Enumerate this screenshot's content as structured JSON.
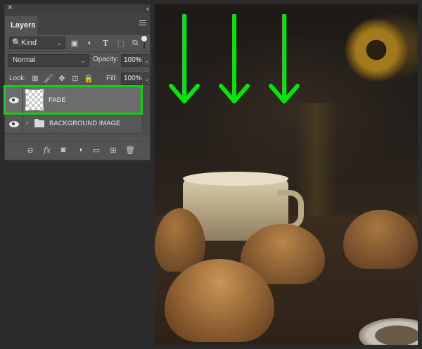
{
  "panel": {
    "title": "Layers",
    "close_glyph": "✕",
    "collapse_glyph": "‹‹",
    "filter": {
      "kind_label": "Kind",
      "search_glyph": "🔍",
      "chevron": "⌄",
      "icons": [
        {
          "name": "pixel-layer-filter-icon",
          "glyph": "▣"
        },
        {
          "name": "adjustment-layer-filter-icon",
          "glyph": "◐"
        },
        {
          "name": "type-layer-filter-icon",
          "glyph": "T"
        },
        {
          "name": "shape-layer-filter-icon",
          "glyph": "⬚"
        },
        {
          "name": "smart-object-filter-icon",
          "glyph": "⧉"
        }
      ]
    },
    "blend": {
      "mode": "Normal",
      "opacity_label": "Opacity:",
      "opacity_value": "100%",
      "chevron": "⌄"
    },
    "lock": {
      "label": "Lock:",
      "icons": [
        {
          "name": "lock-transparent-pixels-icon",
          "glyph": "⊠"
        },
        {
          "name": "lock-image-pixels-icon",
          "glyph": "🖌"
        },
        {
          "name": "lock-position-icon",
          "glyph": "✥"
        },
        {
          "name": "lock-artboard-icon",
          "glyph": "⊡"
        },
        {
          "name": "lock-all-icon",
          "glyph": "🔒"
        }
      ],
      "fill_label": "Fill:",
      "fill_value": "100%",
      "chevron": "⌄"
    },
    "layers": [
      {
        "name": "FADE",
        "visible": true,
        "selected": true
      },
      {
        "name": "BACKGROUND IMAGE",
        "visible": true,
        "selected": false,
        "is_group": true,
        "twisty": "›"
      }
    ],
    "footer": [
      {
        "name": "link-layers-icon",
        "glyph": "⊖"
      },
      {
        "name": "layer-style-icon",
        "glyph": "fx"
      },
      {
        "name": "add-mask-icon",
        "glyph": "◙"
      },
      {
        "name": "new-adjustment-layer-icon",
        "glyph": "◑"
      },
      {
        "name": "new-group-icon",
        "glyph": "▭"
      },
      {
        "name": "new-layer-icon",
        "glyph": "⊞"
      },
      {
        "name": "delete-layer-icon",
        "glyph": "🗑"
      }
    ]
  },
  "canvas": {
    "arrow_color": "#00e600",
    "arrow_count": 3
  },
  "colors": {
    "selection_outline": "#12d012",
    "panel_bg": "#535353"
  }
}
